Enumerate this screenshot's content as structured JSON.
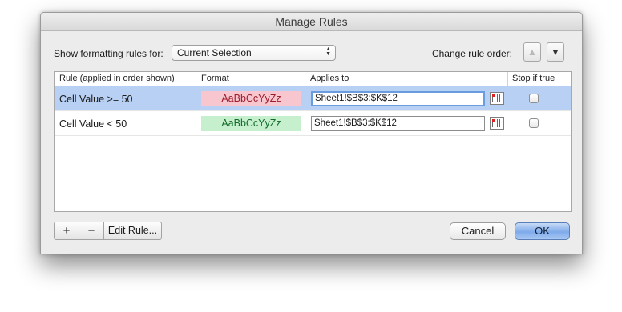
{
  "window": {
    "title": "Manage Rules"
  },
  "toolbar": {
    "show_label": "Show formatting rules for:",
    "selection_value": "Current Selection",
    "order_label": "Change rule order:"
  },
  "table": {
    "headers": [
      "Rule (applied in order shown)",
      "Format",
      "Applies to",
      "Stop if true"
    ],
    "rows": [
      {
        "rule": "Cell Value >= 50",
        "format_sample": "AaBbCcYyZz",
        "applies_to": "Sheet1!$B$3:$K$12",
        "stop_if_true": false,
        "format_bg": "#f8c6ce",
        "format_fg": "#9c1c2c",
        "selected": true
      },
      {
        "rule": "Cell Value < 50",
        "format_sample": "AaBbCcYyZz",
        "applies_to": "Sheet1!$B$3:$K$12",
        "stop_if_true": false,
        "format_bg": "#c6efce",
        "format_fg": "#116b2a",
        "selected": false
      }
    ]
  },
  "bottom": {
    "add_label": "+",
    "remove_label": "−",
    "edit_label": "Edit Rule...",
    "cancel_label": "Cancel",
    "ok_label": "OK"
  },
  "icons": {
    "move_up": "arrow-up-icon",
    "move_down": "arrow-down-icon",
    "range_picker": "range-select-icon"
  }
}
